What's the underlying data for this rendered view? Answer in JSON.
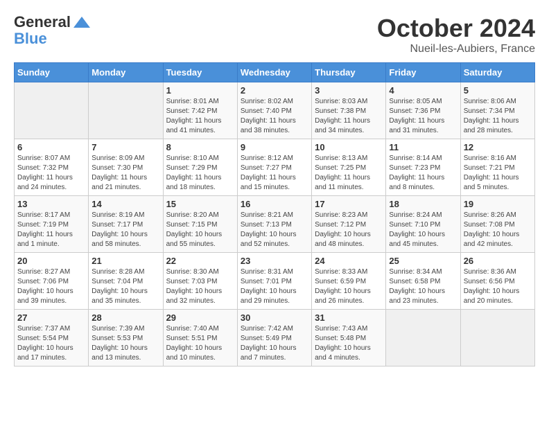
{
  "header": {
    "logo_line1": "General",
    "logo_line2": "Blue",
    "month": "October 2024",
    "location": "Nueil-les-Aubiers, France"
  },
  "days_of_week": [
    "Sunday",
    "Monday",
    "Tuesday",
    "Wednesday",
    "Thursday",
    "Friday",
    "Saturday"
  ],
  "weeks": [
    [
      {
        "day": "",
        "sunrise": "",
        "sunset": "",
        "daylight": ""
      },
      {
        "day": "",
        "sunrise": "",
        "sunset": "",
        "daylight": ""
      },
      {
        "day": "1",
        "sunrise": "Sunrise: 8:01 AM",
        "sunset": "Sunset: 7:42 PM",
        "daylight": "Daylight: 11 hours and 41 minutes."
      },
      {
        "day": "2",
        "sunrise": "Sunrise: 8:02 AM",
        "sunset": "Sunset: 7:40 PM",
        "daylight": "Daylight: 11 hours and 38 minutes."
      },
      {
        "day": "3",
        "sunrise": "Sunrise: 8:03 AM",
        "sunset": "Sunset: 7:38 PM",
        "daylight": "Daylight: 11 hours and 34 minutes."
      },
      {
        "day": "4",
        "sunrise": "Sunrise: 8:05 AM",
        "sunset": "Sunset: 7:36 PM",
        "daylight": "Daylight: 11 hours and 31 minutes."
      },
      {
        "day": "5",
        "sunrise": "Sunrise: 8:06 AM",
        "sunset": "Sunset: 7:34 PM",
        "daylight": "Daylight: 11 hours and 28 minutes."
      }
    ],
    [
      {
        "day": "6",
        "sunrise": "Sunrise: 8:07 AM",
        "sunset": "Sunset: 7:32 PM",
        "daylight": "Daylight: 11 hours and 24 minutes."
      },
      {
        "day": "7",
        "sunrise": "Sunrise: 8:09 AM",
        "sunset": "Sunset: 7:30 PM",
        "daylight": "Daylight: 11 hours and 21 minutes."
      },
      {
        "day": "8",
        "sunrise": "Sunrise: 8:10 AM",
        "sunset": "Sunset: 7:29 PM",
        "daylight": "Daylight: 11 hours and 18 minutes."
      },
      {
        "day": "9",
        "sunrise": "Sunrise: 8:12 AM",
        "sunset": "Sunset: 7:27 PM",
        "daylight": "Daylight: 11 hours and 15 minutes."
      },
      {
        "day": "10",
        "sunrise": "Sunrise: 8:13 AM",
        "sunset": "Sunset: 7:25 PM",
        "daylight": "Daylight: 11 hours and 11 minutes."
      },
      {
        "day": "11",
        "sunrise": "Sunrise: 8:14 AM",
        "sunset": "Sunset: 7:23 PM",
        "daylight": "Daylight: 11 hours and 8 minutes."
      },
      {
        "day": "12",
        "sunrise": "Sunrise: 8:16 AM",
        "sunset": "Sunset: 7:21 PM",
        "daylight": "Daylight: 11 hours and 5 minutes."
      }
    ],
    [
      {
        "day": "13",
        "sunrise": "Sunrise: 8:17 AM",
        "sunset": "Sunset: 7:19 PM",
        "daylight": "Daylight: 11 hours and 1 minute."
      },
      {
        "day": "14",
        "sunrise": "Sunrise: 8:19 AM",
        "sunset": "Sunset: 7:17 PM",
        "daylight": "Daylight: 10 hours and 58 minutes."
      },
      {
        "day": "15",
        "sunrise": "Sunrise: 8:20 AM",
        "sunset": "Sunset: 7:15 PM",
        "daylight": "Daylight: 10 hours and 55 minutes."
      },
      {
        "day": "16",
        "sunrise": "Sunrise: 8:21 AM",
        "sunset": "Sunset: 7:13 PM",
        "daylight": "Daylight: 10 hours and 52 minutes."
      },
      {
        "day": "17",
        "sunrise": "Sunrise: 8:23 AM",
        "sunset": "Sunset: 7:12 PM",
        "daylight": "Daylight: 10 hours and 48 minutes."
      },
      {
        "day": "18",
        "sunrise": "Sunrise: 8:24 AM",
        "sunset": "Sunset: 7:10 PM",
        "daylight": "Daylight: 10 hours and 45 minutes."
      },
      {
        "day": "19",
        "sunrise": "Sunrise: 8:26 AM",
        "sunset": "Sunset: 7:08 PM",
        "daylight": "Daylight: 10 hours and 42 minutes."
      }
    ],
    [
      {
        "day": "20",
        "sunrise": "Sunrise: 8:27 AM",
        "sunset": "Sunset: 7:06 PM",
        "daylight": "Daylight: 10 hours and 39 minutes."
      },
      {
        "day": "21",
        "sunrise": "Sunrise: 8:28 AM",
        "sunset": "Sunset: 7:04 PM",
        "daylight": "Daylight: 10 hours and 35 minutes."
      },
      {
        "day": "22",
        "sunrise": "Sunrise: 8:30 AM",
        "sunset": "Sunset: 7:03 PM",
        "daylight": "Daylight: 10 hours and 32 minutes."
      },
      {
        "day": "23",
        "sunrise": "Sunrise: 8:31 AM",
        "sunset": "Sunset: 7:01 PM",
        "daylight": "Daylight: 10 hours and 29 minutes."
      },
      {
        "day": "24",
        "sunrise": "Sunrise: 8:33 AM",
        "sunset": "Sunset: 6:59 PM",
        "daylight": "Daylight: 10 hours and 26 minutes."
      },
      {
        "day": "25",
        "sunrise": "Sunrise: 8:34 AM",
        "sunset": "Sunset: 6:58 PM",
        "daylight": "Daylight: 10 hours and 23 minutes."
      },
      {
        "day": "26",
        "sunrise": "Sunrise: 8:36 AM",
        "sunset": "Sunset: 6:56 PM",
        "daylight": "Daylight: 10 hours and 20 minutes."
      }
    ],
    [
      {
        "day": "27",
        "sunrise": "Sunrise: 7:37 AM",
        "sunset": "Sunset: 5:54 PM",
        "daylight": "Daylight: 10 hours and 17 minutes."
      },
      {
        "day": "28",
        "sunrise": "Sunrise: 7:39 AM",
        "sunset": "Sunset: 5:53 PM",
        "daylight": "Daylight: 10 hours and 13 minutes."
      },
      {
        "day": "29",
        "sunrise": "Sunrise: 7:40 AM",
        "sunset": "Sunset: 5:51 PM",
        "daylight": "Daylight: 10 hours and 10 minutes."
      },
      {
        "day": "30",
        "sunrise": "Sunrise: 7:42 AM",
        "sunset": "Sunset: 5:49 PM",
        "daylight": "Daylight: 10 hours and 7 minutes."
      },
      {
        "day": "31",
        "sunrise": "Sunrise: 7:43 AM",
        "sunset": "Sunset: 5:48 PM",
        "daylight": "Daylight: 10 hours and 4 minutes."
      },
      {
        "day": "",
        "sunrise": "",
        "sunset": "",
        "daylight": ""
      },
      {
        "day": "",
        "sunrise": "",
        "sunset": "",
        "daylight": ""
      }
    ]
  ]
}
